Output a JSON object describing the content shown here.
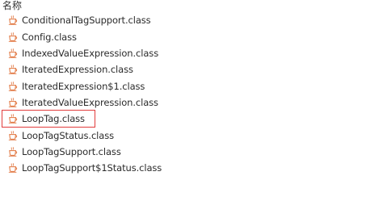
{
  "header": {
    "column_name": "名称"
  },
  "files": [
    {
      "name": "ConditionalTagSupport.class",
      "icon": "java-class-file-icon"
    },
    {
      "name": "Config.class",
      "icon": "java-class-file-icon"
    },
    {
      "name": "IndexedValueExpression.class",
      "icon": "java-class-file-icon"
    },
    {
      "name": "IteratedExpression.class",
      "icon": "java-class-file-icon"
    },
    {
      "name": "IteratedExpression$1.class",
      "icon": "java-class-file-icon"
    },
    {
      "name": "IteratedValueExpression.class",
      "icon": "java-class-file-icon"
    },
    {
      "name": "LoopTag.class",
      "icon": "java-class-file-icon",
      "highlighted": true
    },
    {
      "name": "LoopTagStatus.class",
      "icon": "java-class-file-icon"
    },
    {
      "name": "LoopTagSupport.class",
      "icon": "java-class-file-icon"
    },
    {
      "name": "LoopTagSupport$1Status.class",
      "icon": "java-class-file-icon"
    }
  ],
  "colors": {
    "highlight_border": "#e23c3c",
    "icon_cup": "#e0723a"
  }
}
